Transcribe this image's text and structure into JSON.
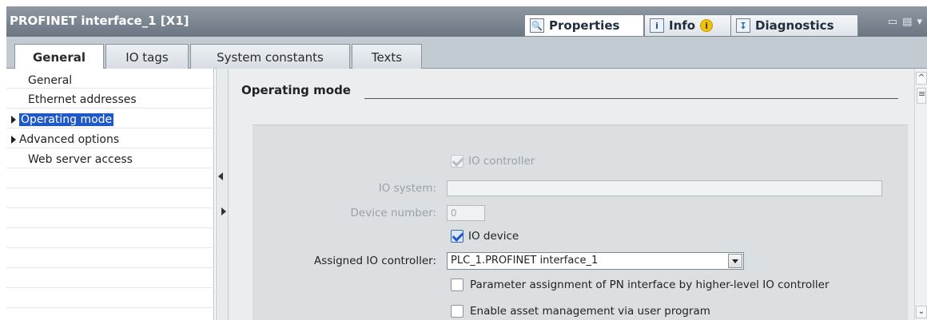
{
  "window": {
    "title": "PROFINET interface_1 [X1]",
    "tabs": [
      {
        "label": "Properties",
        "icon": "properties-icon"
      },
      {
        "label": "Info",
        "icon": "info-icon",
        "badge": "i"
      },
      {
        "label": "Diagnostics",
        "icon": "diagnostics-icon"
      }
    ],
    "controls": [
      "restore-icon",
      "minimize-icon",
      "menu-icon"
    ]
  },
  "tabs": [
    {
      "label": "General",
      "active": true
    },
    {
      "label": "IO tags"
    },
    {
      "label": "System constants"
    },
    {
      "label": "Texts"
    }
  ],
  "nav": {
    "items": [
      {
        "label": "General",
        "expandable": false
      },
      {
        "label": "Ethernet addresses",
        "expandable": false
      },
      {
        "label": "Operating mode",
        "expandable": true,
        "selected": true
      },
      {
        "label": "Advanced options",
        "expandable": true
      },
      {
        "label": "Web server access",
        "expandable": false
      }
    ]
  },
  "section": {
    "title": "Operating mode"
  },
  "form": {
    "io_controller_label": "IO controller",
    "io_controller_checked": true,
    "io_system_label": "IO system:",
    "io_system_value": "",
    "device_number_label": "Device number:",
    "device_number_value": "0",
    "io_device_label": "IO device",
    "io_device_checked": true,
    "assigned_controller_label": "Assigned IO controller:",
    "assigned_controller_value": "PLC_1.PROFINET interface_1",
    "param_assign_label": "Parameter assignment of PN interface by higher-level IO controller",
    "param_assign_checked": false,
    "asset_mgmt_label": "Enable asset management via user program",
    "asset_mgmt_checked": false
  },
  "colors": {
    "selection": "#1f58c7",
    "titlebar": "#7a848f"
  }
}
